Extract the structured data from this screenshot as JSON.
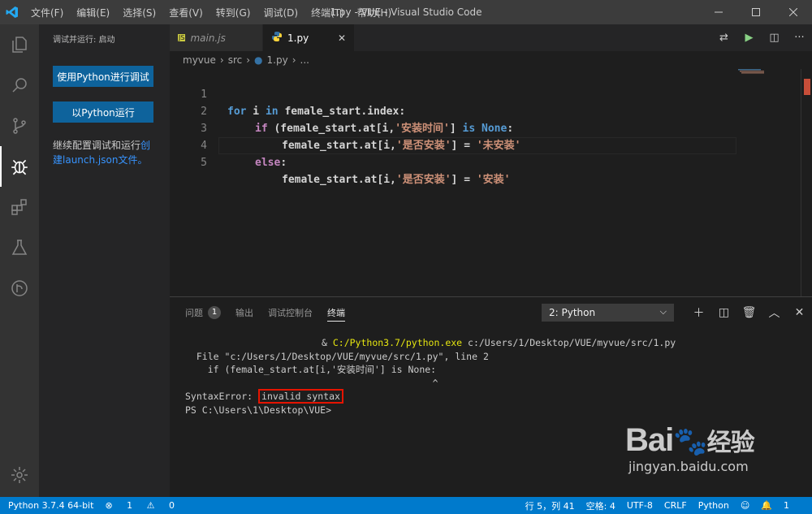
{
  "window": {
    "title": "1.py - VUE - Visual Studio Code",
    "menu": [
      "文件(F)",
      "编辑(E)",
      "选择(S)",
      "查看(V)",
      "转到(G)",
      "调试(D)",
      "终端(T)",
      "帮助(H)"
    ]
  },
  "sidebar": {
    "title": "调试并运行: 启动",
    "debug_python_label": "使用Python进行调试",
    "run_python_label": "以Python运行",
    "config_text": "继续配置调试和运行",
    "config_link_a": "创",
    "config_link_b": "建launch.json文件。"
  },
  "tabs": [
    {
      "label": "main.js",
      "icon": "JS"
    },
    {
      "label": "1.py",
      "icon": "python-icon"
    }
  ],
  "breadcrumb": [
    "myvue",
    "src",
    "1.py",
    "..."
  ],
  "editor": {
    "line_numbers": [
      "1",
      "2",
      "3",
      "4",
      "5"
    ],
    "lines": [
      {
        "kw": "for",
        "a": " i ",
        "kw2": "in",
        "b": " female_start.index:"
      },
      {
        "kw": "if",
        "a": " (female_start.at[i,",
        "str": "'安装时间'",
        "b": "] ",
        "kw2": "is",
        "c": " ",
        "none": "None",
        "d": ":"
      },
      {
        "a": "female_start.at[i,",
        "str": "'是否安装'",
        "b": "] = ",
        "str2": "'未安装'"
      },
      {
        "kw": "else",
        "a": ":"
      },
      {
        "a": "female_start.at[i,",
        "str": "'是否安装'",
        "b": "] = ",
        "str2": "'安装'"
      }
    ]
  },
  "panel": {
    "tabs": [
      "问题",
      "输出",
      "调试控制台",
      "终端"
    ],
    "problems_count": "1",
    "terminal_select": "2: Python",
    "terminal": {
      "cmd_prefix": "& ",
      "cmd_exe": "C:/Python3.7/python.exe",
      "cmd_arg": " c:/Users/1/Desktop/VUE/myvue/src/1.py",
      "line2": "  File \"c:/Users/1/Desktop/VUE/myvue/src/1.py\", line 2",
      "line3": "    if (female_start.at[i,'安装时间'] is None:",
      "line4": "                                            ^",
      "err_prefix": "SyntaxError: ",
      "err_msg": "invalid syntax",
      "prompt": "PS C:\\Users\\1\\Desktop\\VUE>"
    }
  },
  "statusbar": {
    "python": "Python 3.7.4 64-bit",
    "errors": "1",
    "warnings": "0",
    "position": "行 5，列 41",
    "spaces": "空格: 4",
    "encoding": "UTF-8",
    "eol": "CRLF",
    "language": "Python",
    "notifications": "1"
  },
  "watermark": {
    "brand": "Bai",
    "brand_cn": "经验",
    "url": "jingyan.baidu.com"
  },
  "colors": {
    "accent": "#007acc",
    "button": "#0e639c",
    "highlight": "#e51400"
  }
}
